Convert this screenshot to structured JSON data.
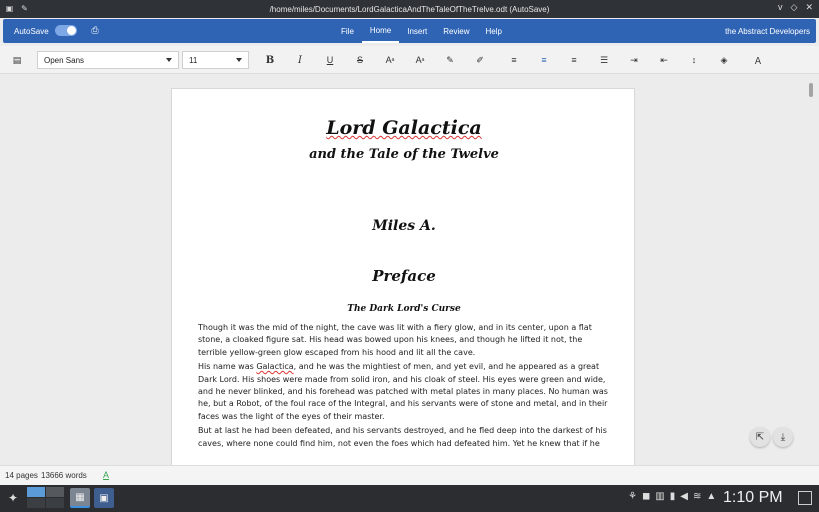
{
  "window": {
    "title": "/home/miles/Documents/LordGalacticaAndTheTaleOfTheTrelve.odt (AutoSave)",
    "left_icons": [
      "app-icon",
      "pin-icon"
    ],
    "controls": [
      "v",
      "◇",
      "✕"
    ]
  },
  "appbar": {
    "autosave_label": "AutoSave",
    "autosave_on": true,
    "menu": [
      {
        "label": "File",
        "active": false
      },
      {
        "label": "Home",
        "active": true
      },
      {
        "label": "Insert",
        "active": false
      },
      {
        "label": "Review",
        "active": false
      },
      {
        "label": "Help",
        "active": false
      }
    ],
    "brand": "the Abstract Developers"
  },
  "toolbar": {
    "font_family": "Open Sans",
    "font_size": "11",
    "icons": [
      "clipboard-icon",
      "bold-icon",
      "italic-icon",
      "underline-icon",
      "strikethrough-icon",
      "superscript-icon",
      "subscript-icon",
      "brush-icon",
      "eraser-icon",
      "align-left-icon",
      "align-center-icon",
      "align-right-icon",
      "justify-icon",
      "indent-icon",
      "outdent-icon",
      "line-spacing-icon",
      "fill-icon",
      "clear-format-icon"
    ],
    "labels": {
      "bold": "B",
      "italic": "I",
      "underline": "U",
      "strike": "S",
      "super": "A",
      "sub": "A"
    }
  },
  "document": {
    "title": "Lord Galactica",
    "subtitle": "and the Tale of the Twelve",
    "author": "Miles A.",
    "section": "Preface",
    "chapter": "The Dark Lord's Curse",
    "paragraphs": [
      "Though it was the mid of the night, the cave was lit with a fiery glow, and in its center, upon a flat stone, a cloaked figure sat. His head was bowed upon his knees, and though he lifted it not, the terrible yellow-green glow escaped from his hood and lit all the cave.",
      "His name was Galactica, and he was the mightiest of men, and yet evil, and he appeared as a great Dark Lord. His shoes were made from solid iron, and his cloak of steel. His eyes were green and wide, and he never blinked, and his forehead was patched with metal plates in many places. No human was he, but a Robot, of the foul race of the Integral, and his servants were of stone and metal, and in their faces was the light of the eyes of their master.",
      "But at last he had been defeated, and his servants destroyed, and he fled deep into the darkest of his caves, where none could find him, not even the foes which had defeated him. Yet he knew that if he"
    ],
    "para2_prefix": "His name was ",
    "para2_word": "Galactica",
    "para2_suffix": ", and he was the mightiest of men, and yet evil, and he appeared as a great Dark Lord. His shoes were made from solid iron, and his cloak of steel. His eyes were green and wide, and he never blinked, and his forehead was patched with metal plates in many places. No human was he, but a Robot, of the foul race of the Integral, and his servants were of stone and metal, and in their faces was the light of the eyes of their master."
  },
  "status": {
    "pages": "14 pages",
    "words": "13666 words",
    "spell": "A"
  },
  "taskbar": {
    "clock": "1:10 PM",
    "tray_icons": [
      "network-icon",
      "gamepad-icon",
      "clipboard-icon",
      "battery-icon",
      "volume-icon",
      "wifi-icon",
      "expand-icon"
    ]
  },
  "colors": {
    "accent": "#2f64b4",
    "taskbar": "#2b2d30",
    "spell_ok": "#3aa653"
  }
}
